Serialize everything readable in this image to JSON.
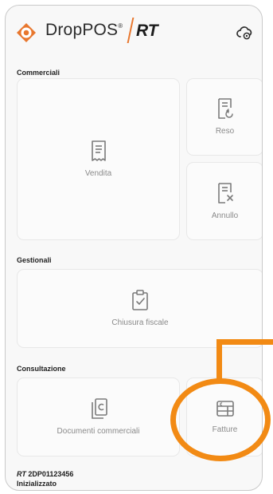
{
  "app": {
    "brand_name": "DropPOS",
    "brand_trademark": "®",
    "brand_suffix": "RT",
    "brand_color": "#e8772e",
    "icons": {
      "logo": "droplet-logo-icon",
      "settings": "settings-cloud-icon"
    }
  },
  "sections": {
    "commerciali": "Commerciali",
    "gestionali": "Gestionali",
    "consultazione": "Consultazione"
  },
  "tiles": {
    "vendita": {
      "label": "Vendita",
      "icon": "receipt-icon"
    },
    "reso": {
      "label": "Reso",
      "icon": "receipt-return-icon"
    },
    "annullo": {
      "label": "Annullo",
      "icon": "receipt-cancel-icon"
    },
    "chiusura": {
      "label": "Chiusura fiscale",
      "icon": "clipboard-check-icon"
    },
    "documenti": {
      "label": "Documenti commerciali",
      "icon": "documents-icon"
    },
    "fatture": {
      "label": "Fatture",
      "icon": "invoice-icon"
    }
  },
  "footer": {
    "rt_prefix": "RT",
    "device_id": "2DP01123456",
    "status": "Inizializzato"
  },
  "annotation_color": "#f28a14"
}
